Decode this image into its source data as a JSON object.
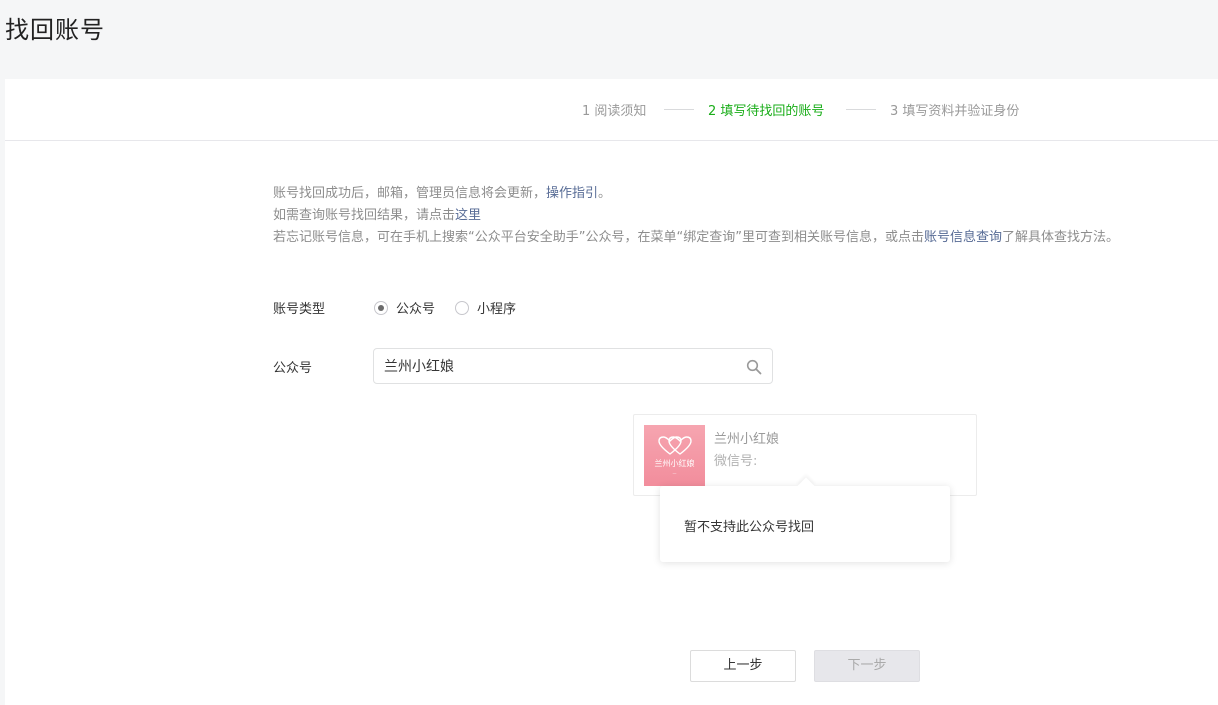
{
  "page": {
    "title": "找回账号"
  },
  "steps": [
    {
      "label": "1 阅读须知",
      "state": "done"
    },
    {
      "label": "2 填写待找回的账号",
      "state": "active"
    },
    {
      "label": "3 填写资料并验证身份",
      "state": "todo"
    }
  ],
  "notice": {
    "line1_text": "账号找回成功后，邮箱，管理员信息将会更新，",
    "line1_link": "操作指引",
    "line1_end": "。",
    "line2_text": "如需查询账号找回结果，请点击",
    "line2_link": "这里",
    "line3_text": "若忘记账号信息，可在手机上搜索“公众平台安全助手”公众号，在菜单“绑定查询”里可查到相关账号信息，或点击",
    "line3_link": "账号信息查询",
    "line3_end": "了解具体查找方法。"
  },
  "form": {
    "type_label": "账号类型",
    "type_options": [
      {
        "label": "公众号",
        "checked": true
      },
      {
        "label": "小程序",
        "checked": false
      }
    ],
    "account_label": "公众号",
    "search_value": "兰州小红娘"
  },
  "result": {
    "avatar_text": "兰州小红娘",
    "name": "兰州小红娘",
    "wechat_id_label": "微信号:"
  },
  "tooltip": {
    "text": "暂不支持此公众号找回"
  },
  "buttons": {
    "prev": "上一步",
    "next": "下一步"
  },
  "colors": {
    "accent_green": "#1aad19",
    "link_blue": "#576b95",
    "avatar_pink": "#f49aa7"
  }
}
